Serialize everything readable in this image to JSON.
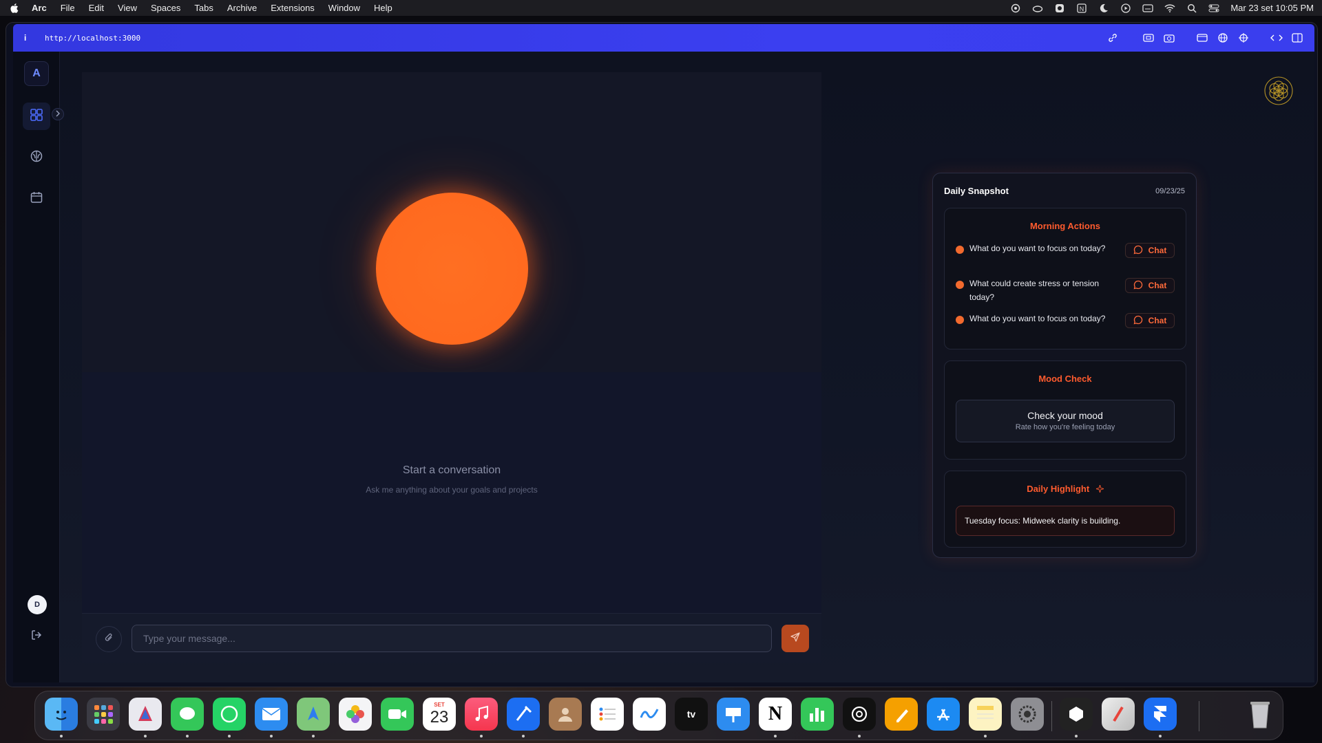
{
  "menubar": {
    "app_name": "Arc",
    "items": [
      "File",
      "Edit",
      "View",
      "Spaces",
      "Tabs",
      "Archive",
      "Extensions",
      "Window",
      "Help"
    ],
    "status_icons": [
      "openai-icon",
      "cloud-icon",
      "bot-icon",
      "notion-icon",
      "moon-icon",
      "play-icon",
      "keyboard-icon",
      "wifi-icon",
      "search-icon",
      "control-center-icon"
    ],
    "clock": "Mar 23 set  10:05 PM"
  },
  "browser": {
    "info_label": "i",
    "url": "http://localhost:3000",
    "accent": "#3338e0"
  },
  "sidebar": {
    "logo": "A",
    "items": [
      "dashboard-icon",
      "brain-icon",
      "calendar-icon"
    ],
    "avatar": "D"
  },
  "chat": {
    "empty_title": "Start a conversation",
    "empty_subtitle": "Ask me anything about your goals and projects",
    "input_placeholder": "Type your message...",
    "orb_color": "#ff6a1f"
  },
  "snapshot": {
    "title": "Daily Snapshot",
    "date": "09/23/25",
    "morning": {
      "title": "Morning Actions",
      "chat_label": "Chat",
      "actions": [
        "What do you want to focus on today?",
        "What could create stress or tension today?",
        "What do you want to focus on today?"
      ]
    },
    "mood": {
      "title": "Mood Check",
      "button_title": "Check your mood",
      "button_subtitle": "Rate how you're feeling today"
    },
    "highlight": {
      "title": "Daily Highlight",
      "text": "Tuesday focus: Midweek clarity is building."
    },
    "accent": "#ff5b2e"
  },
  "dock": {
    "calendar_month": "SET",
    "calendar_day": "23",
    "apps": [
      "finder",
      "launchpad",
      "craft",
      "messages",
      "whatsapp",
      "mail",
      "maps",
      "photos",
      "facetime",
      "calendar",
      "music",
      "xcode",
      "contacts",
      "reminders",
      "freeform",
      "tv",
      "keynote",
      "notion",
      "numbers",
      "chatgpt",
      "pages",
      "app-store",
      "notes",
      "system-settings",
      "bezel",
      "pencil-app",
      "framer",
      "trash"
    ]
  }
}
